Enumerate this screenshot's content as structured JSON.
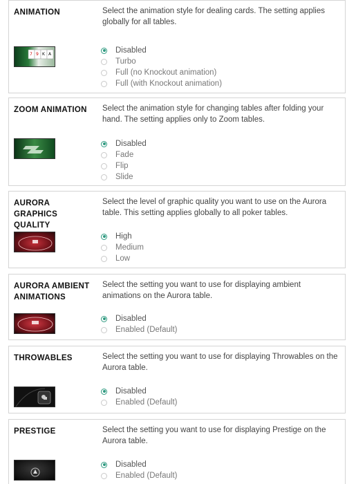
{
  "sections": [
    {
      "title": "ANIMATION",
      "description": "Select the animation style for dealing cards. The setting applies globally for all tables.",
      "options": [
        "Disabled",
        "Turbo",
        "Full (no Knockout animation)",
        "Full (with Knockout animation)"
      ],
      "selected": "Disabled",
      "thumbnail": "card-dealing-preview"
    },
    {
      "title": "ZOOM ANIMATION",
      "description": "Select the animation style for changing tables after folding your hand. The setting applies only to Zoom tables.",
      "options": [
        "Disabled",
        "Fade",
        "Flip",
        "Slide"
      ],
      "selected": "Disabled",
      "thumbnail": "zoom-table-preview"
    },
    {
      "title": "AURORA GRAPHICS QUALITY",
      "description": "Select the level of graphic quality you want to use on the Aurora table. This setting applies globally to all poker tables.",
      "options": [
        "High",
        "Medium",
        "Low"
      ],
      "selected": "High",
      "thumbnail": "aurora-table-preview"
    },
    {
      "title": "AURORA AMBIENT ANIMATIONS",
      "description": "Select the setting you want to use for displaying ambient animations on the Aurora table.",
      "options": [
        "Disabled",
        "Enabled (Default)"
      ],
      "selected": "Disabled",
      "thumbnail": "aurora-ambient-preview"
    },
    {
      "title": "THROWABLES",
      "description": "Select the setting you want to use for displaying Throwables on the Aurora table.",
      "options": [
        "Disabled",
        "Enabled (Default)"
      ],
      "selected": "Disabled",
      "thumbnail": "throwables-preview"
    },
    {
      "title": "PRESTIGE",
      "description": "Select the setting you want to use for displaying Prestige on the Aurora table.",
      "options": [
        "Disabled",
        "Enabled (Default)"
      ],
      "selected": "Disabled",
      "thumbnail": "prestige-preview"
    }
  ],
  "colors": {
    "radio_selected": "#2f9a80",
    "card_border": "#d4d4d4",
    "title": "#111111",
    "text": "#444444"
  }
}
